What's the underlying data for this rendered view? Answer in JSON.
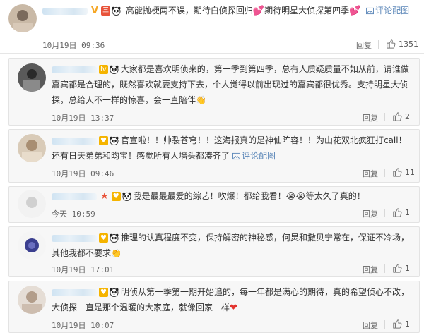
{
  "comments": [
    {
      "segments": [
        {
          "t": "text",
          "v": "高能抛梗两不误，期待白侦探回归"
        },
        {
          "t": "heart"
        },
        {
          "t": "text",
          "v": "期待明星大侦探第四季"
        },
        {
          "t": "heart"
        }
      ],
      "link_label": "评论配图",
      "time": "10月19日 09:36",
      "reply": "回复",
      "likes": "1351"
    },
    {
      "text": "大家都是喜欢明侦来的，第一季到第四季，总有人质疑质量不如从前，请谁做嘉宾都是合理的，既然喜欢就要支持下去，个人觉得以前出现过的嘉宾都很优秀。支持明星大侦探，总给人不一样的惊喜，会一直陪伴",
      "time": "10月19日 13:37",
      "reply": "回复",
      "likes": "2"
    },
    {
      "text": "官宣啦！！帅裂苍穹！！这海报真的是神仙阵容！！为山花双北疯狂打call！还有日天弟弟和昀宝！感觉所有人墙头都凑齐了",
      "link_label": "评论配图",
      "time": "10月19日 09:46",
      "reply": "回复",
      "likes": "11"
    },
    {
      "text1": "我是最最最爱的综艺！吹爆！都给我看！",
      "text2": "等太久了真的！",
      "time": "今天 10:59",
      "reply": "回复",
      "likes": "1"
    },
    {
      "text": "推理的认真程度不变，保持解密的神秘感，何炅和撒贝宁常在，保证不冷场，其他我都不要求",
      "time": "10月19日 17:01",
      "reply": "回复",
      "likes": "1"
    },
    {
      "text": "明侦从第一季第一期开始追的，每一年都是满心的期待，真的希望侦心不改，大侦探一直是那个温暖的大家庭，就像回家一样",
      "time": "10月19日 10:07",
      "reply": "回复",
      "likes": "1"
    }
  ],
  "colors": {
    "link": "#5a86b8",
    "heart": "#e8437a",
    "meta": "#666666"
  },
  "icons": {
    "like": "thumbs-up-icon",
    "image_link": "image-link-icon",
    "panda": "panda-emoji-icon"
  }
}
